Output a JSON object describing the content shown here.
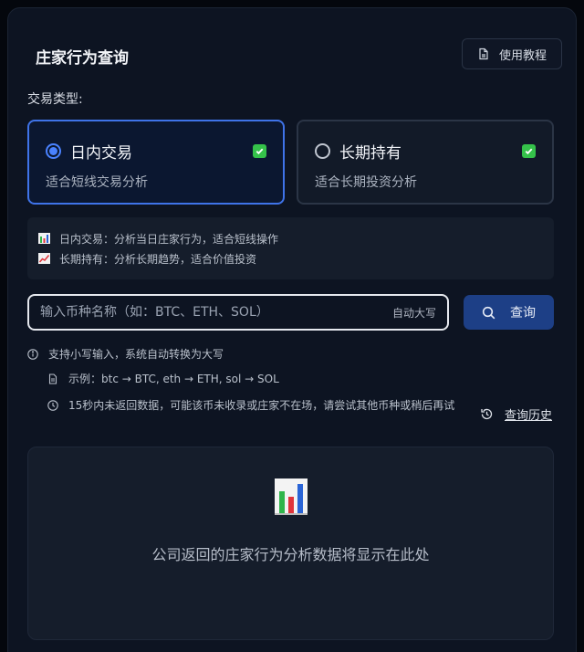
{
  "header": {
    "title": "庄家行为查询",
    "tutorial_label": "使用教程"
  },
  "trade_type": {
    "label": "交易类型:",
    "options": [
      {
        "name": "日内交易",
        "desc": "适合短线交易分析",
        "selected": true
      },
      {
        "name": "长期持有",
        "desc": "适合长期投资分析",
        "selected": false
      }
    ]
  },
  "info": {
    "lines": [
      "日内交易：分析当日庄家行为，适合短线操作",
      "长期持有：分析长期趋势，适合价值投资"
    ]
  },
  "search": {
    "placeholder": "输入币种名称（如：BTC、ETH、SOL）",
    "value": "",
    "auto_upper": "自动大写",
    "button_label": "查询"
  },
  "hints": {
    "lowercase": "支持小写输入，系统自动转换为大写",
    "example": "示例：btc → BTC, eth → ETH, sol → SOL",
    "timeout": "15秒内未返回数据，可能该币未收录或庄家不在场，请尝试其他币种或稍后再试"
  },
  "history_label": "查询历史",
  "result": {
    "placeholder": "公司返回的庄家行为分析数据将显示在此处"
  },
  "colors": {
    "accent": "#3f73e8",
    "check_green": "#35c24a",
    "button_bg": "#1d3f86"
  },
  "icons": [
    "document-icon",
    "radio-icon",
    "checkmark-icon",
    "bar-chart-icon",
    "trend-chart-icon",
    "search-icon",
    "info-icon",
    "file-icon",
    "clock-icon",
    "history-icon"
  ]
}
